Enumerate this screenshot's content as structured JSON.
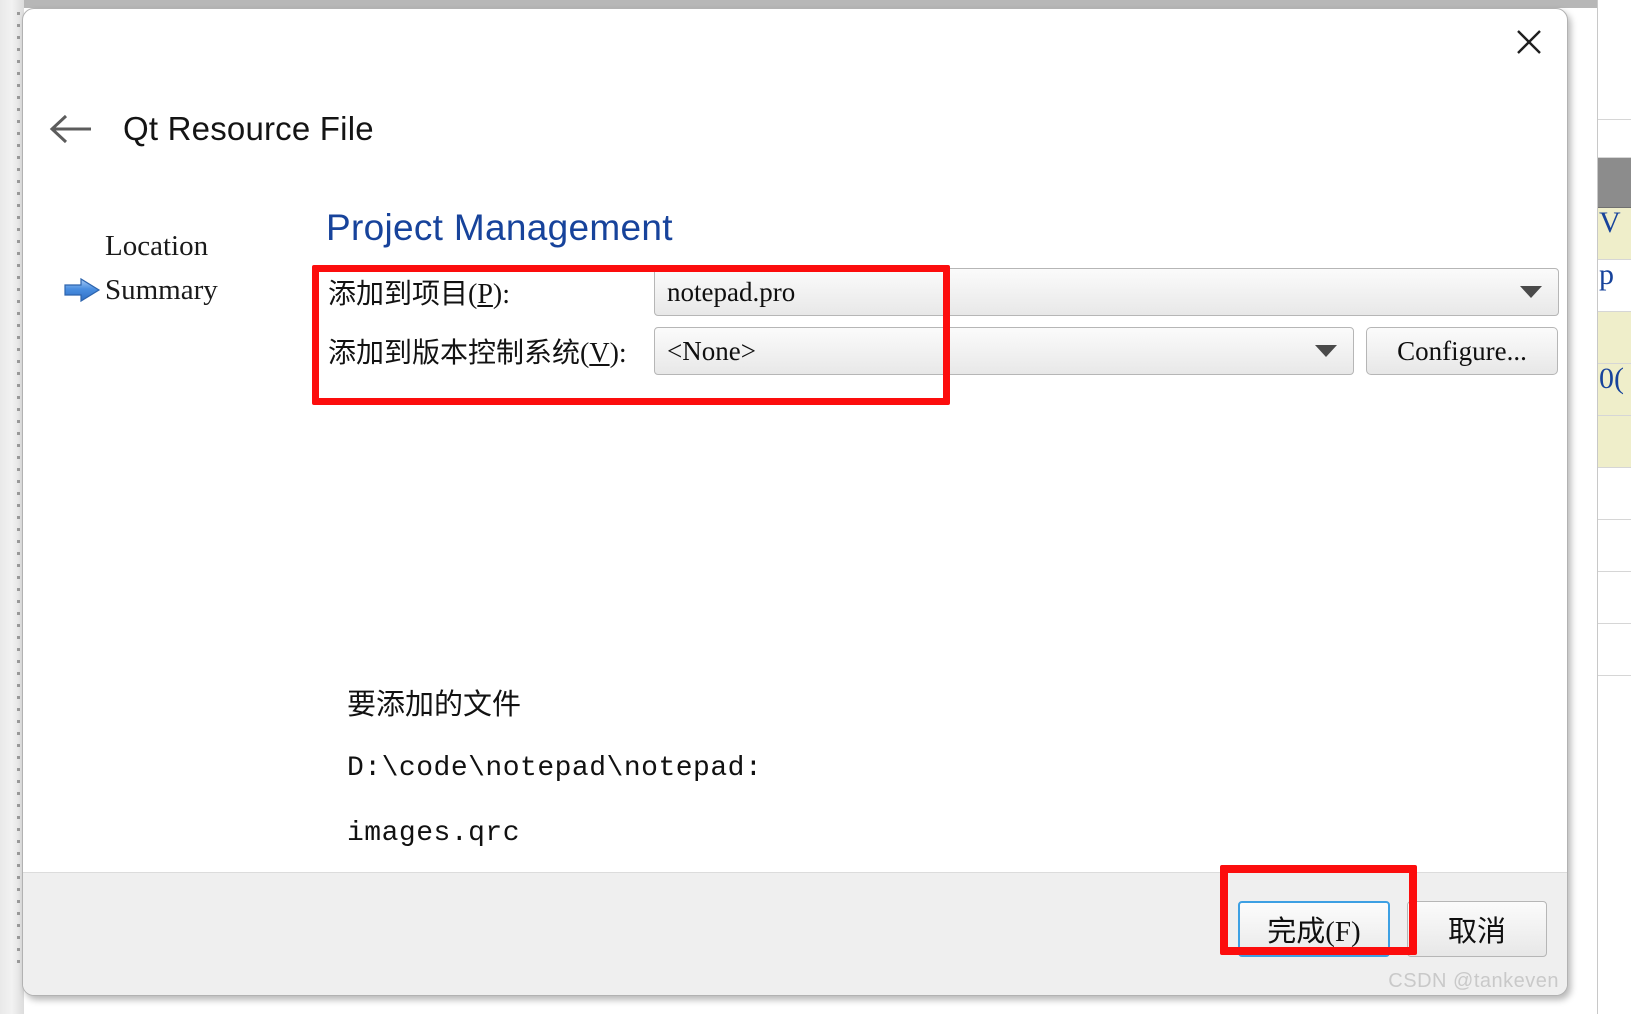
{
  "window": {
    "title": "Qt Resource File",
    "close_icon": "close-icon",
    "back_icon": "back-arrow-icon"
  },
  "steps": [
    {
      "label": "Location",
      "current": false,
      "marker": ""
    },
    {
      "label": "Summary",
      "current": true,
      "marker": "blue-arrow-icon"
    }
  ],
  "page": {
    "heading": "Project Management",
    "heading_color": "#17439b"
  },
  "form": {
    "rows": [
      {
        "label_prefix": "添加到项目(",
        "label_mnemonic": "P",
        "label_suffix": "):",
        "value": "notepad.pro",
        "control": "combobox"
      },
      {
        "label_prefix": "添加到版本控制系统(",
        "label_mnemonic": "V",
        "label_suffix": "):",
        "value": "<None>",
        "control": "combobox"
      }
    ],
    "configure_label": "Configure...",
    "highlight_color": "#fc0d0d"
  },
  "summary": {
    "heading": "要添加的文件",
    "path": "D:\\code\\notepad\\notepad:",
    "files": [
      "images.qrc"
    ]
  },
  "footer": {
    "finish_label": "完成(F)",
    "finish_mnemonic": "F",
    "cancel_label": "取消",
    "finish_accent": "#3da0e3"
  },
  "watermark": "CSDN @tankeven",
  "background": {
    "right_panel_rows": [
      {
        "text": "",
        "style": "plain"
      },
      {
        "text": "",
        "style": "plain"
      },
      {
        "text": "",
        "style": "header"
      },
      {
        "text": "V",
        "style": "tinted"
      },
      {
        "text": "p",
        "style": "plain"
      },
      {
        "text": "",
        "style": "tinted"
      },
      {
        "text": "0(",
        "style": "tinted"
      },
      {
        "text": "",
        "style": "tinted"
      },
      {
        "text": "",
        "style": "plain"
      },
      {
        "text": "",
        "style": "plain"
      },
      {
        "text": "",
        "style": "plain"
      },
      {
        "text": "",
        "style": "plain"
      },
      {
        "text": "",
        "style": "plain"
      }
    ]
  }
}
